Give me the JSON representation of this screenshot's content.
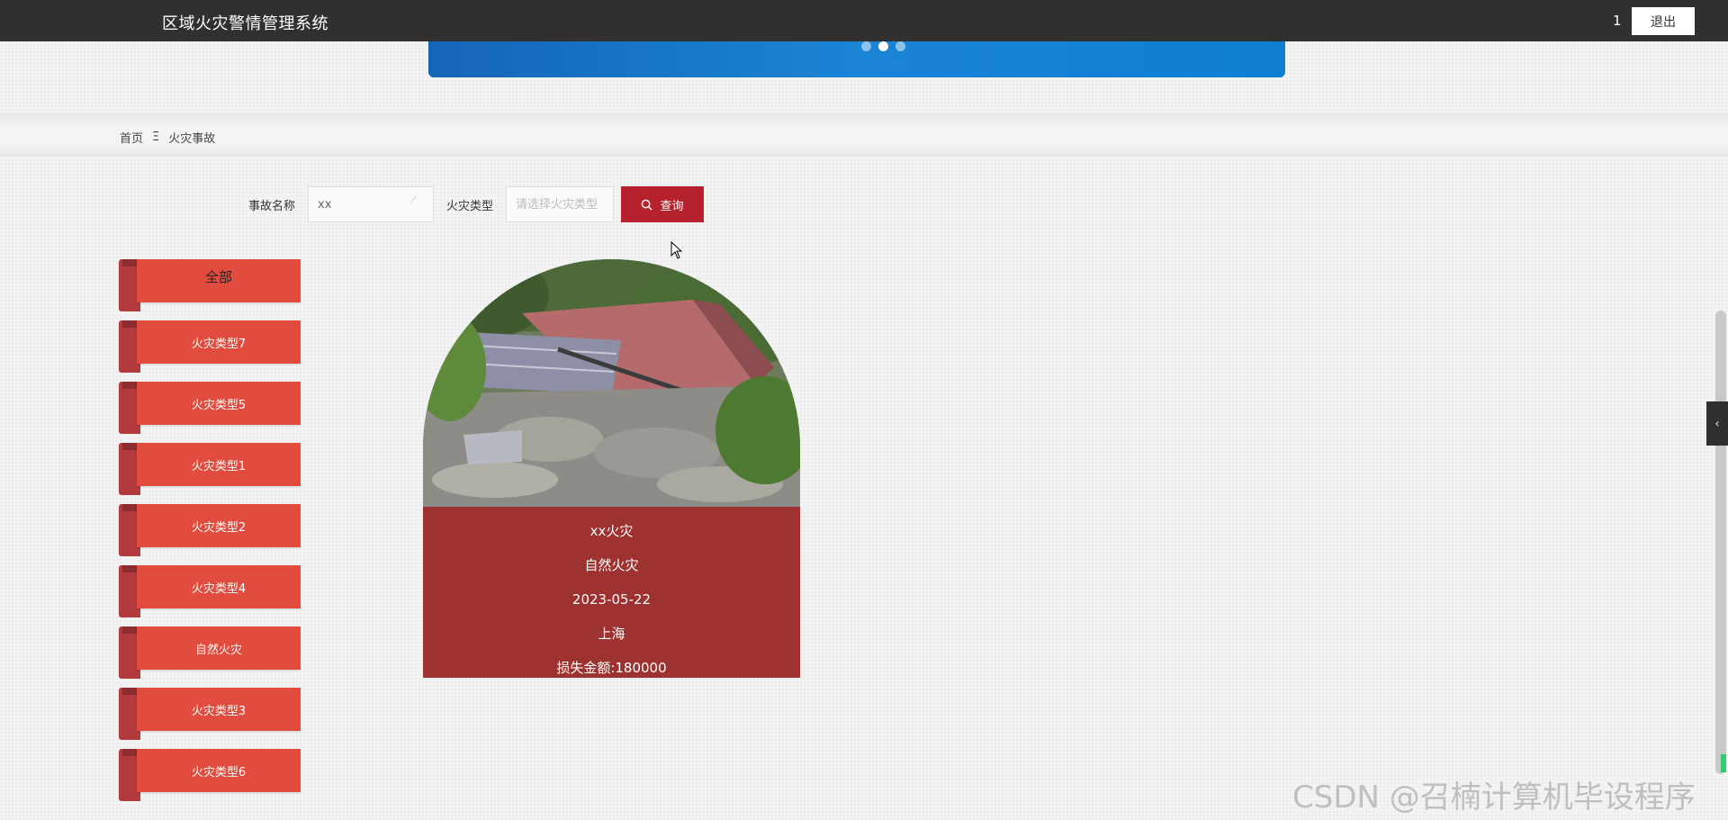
{
  "header": {
    "app_title": "区域火灾警情管理系统",
    "user": "1",
    "logout_label": "退出"
  },
  "breadcrumb": {
    "home": "首页",
    "separator": "Ξ",
    "current": "火灾事故"
  },
  "search": {
    "name_label": "事故名称",
    "name_value": "xx",
    "type_label": "火灾类型",
    "type_placeholder": "请选择火灾类型",
    "button_label": "查询"
  },
  "categories": [
    "全部",
    "火灾类型7",
    "火灾类型5",
    "火灾类型1",
    "火灾类型2",
    "火灾类型4",
    "自然火灾",
    "火灾类型3",
    "火灾类型6"
  ],
  "card": {
    "title": "xx火灾",
    "type": "自然火灾",
    "date": "2023-05-22",
    "location": "上海",
    "loss": "损失金额:180000"
  },
  "side_toggle_icon": "chevron-left-icon",
  "watermark": "CSDN @召楠计算机毕设程序",
  "colors": {
    "header_bg": "#303030",
    "accent_red": "#b5222b",
    "ribbon_red": "#e24c3e",
    "card_red": "#9e3230",
    "banner_blue": "#1a84d6"
  }
}
